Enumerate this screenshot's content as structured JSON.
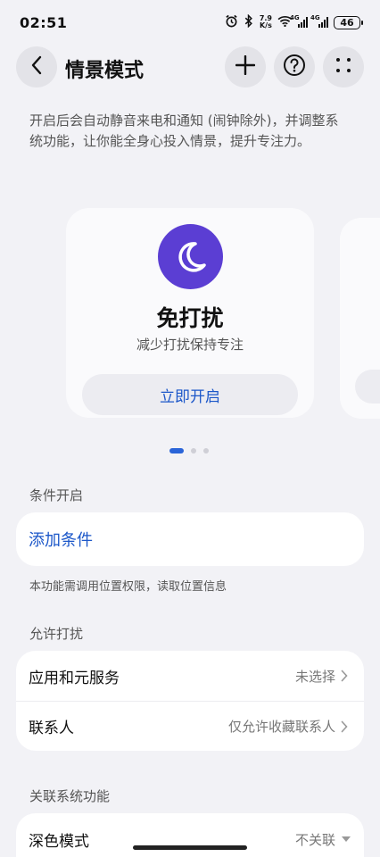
{
  "status": {
    "time": "02:51",
    "net_speed_value": "7.9",
    "net_speed_unit": "K/s",
    "sig1_label": "4G",
    "sig2_label": "4G",
    "battery": "46"
  },
  "header": {
    "title": "情景模式"
  },
  "intro": "开启后会自动静音来电和通知 (闹钟除外)，并调整系统功能，让你能全身心投入情景，提升专注力。",
  "mode_card": {
    "name": "免打扰",
    "desc": "减少打扰保持专注",
    "button": "立即开启",
    "accent": "#5b3ed3"
  },
  "pager": {
    "count": 3,
    "active": 1
  },
  "conditions": {
    "label": "条件开启",
    "add": "添加条件",
    "note": "本功能需调用位置权限，读取位置信息"
  },
  "allow": {
    "label": "允许打扰",
    "rows": [
      {
        "label": "应用和元服务",
        "value": "未选择"
      },
      {
        "label": "联系人",
        "value": "仅允许收藏联系人"
      }
    ]
  },
  "related": {
    "label": "关联系统功能",
    "rows": [
      {
        "label": "深色模式",
        "value": "不关联"
      }
    ]
  },
  "icons": {
    "back": "chevron-left-icon",
    "add": "plus-icon",
    "help": "question-icon",
    "more": "more-dots-icon",
    "mode": "moon-icon"
  },
  "colors": {
    "link": "#1c57c9",
    "background": "#f2f2f6"
  }
}
